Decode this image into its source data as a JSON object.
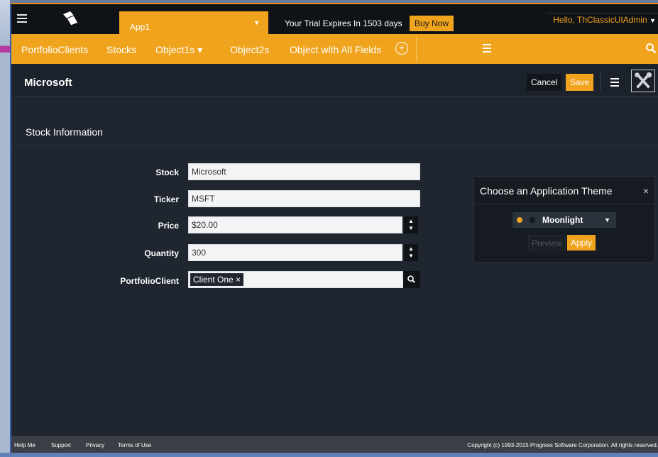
{
  "topbar": {
    "app_label": "App1",
    "trial_text": "Your Trial Expires In 1503 days",
    "buy_now_label": "Buy Now",
    "user_greeting": "Hello, ThClassicUIAdmin",
    "icons": [
      "menu-icon",
      "logo-icon",
      "chevron-down-icon"
    ]
  },
  "nav": {
    "items": [
      {
        "label": "PortfolioClients"
      },
      {
        "label": "Stocks"
      },
      {
        "label": "Object1s ▾"
      },
      {
        "label": "Object2s"
      },
      {
        "label": "Object with All Fields"
      }
    ],
    "icons": [
      "add-icon",
      "menu-icon",
      "search-icon"
    ]
  },
  "header": {
    "title": "Microsoft",
    "cancel_label": "Cancel",
    "save_label": "Save"
  },
  "section": {
    "title": "Stock Information"
  },
  "form": {
    "stock_label": "Stock",
    "stock_value": "Microsoft",
    "ticker_label": "Ticker",
    "ticker_value": "MSFT",
    "price_label": "Price",
    "price_value": "$20.00",
    "quantity_label": "Quantity",
    "quantity_value": "300",
    "client_label": "PortfolioClient",
    "client_chip": "Client One ×"
  },
  "theme_panel": {
    "title": "Choose an Application Theme",
    "close": "×",
    "selected_theme": "Moonlight",
    "preview_label": "Preview",
    "apply_label": "Apply"
  },
  "footer": {
    "links": [
      "Help Me",
      "Support",
      "Privacy",
      "Terms of Use"
    ],
    "copyright": "Copyright (c) 1993-2015 Progress Software Corporation. All rights reserved."
  },
  "colors": {
    "accent": "#f0a31c",
    "background": "#1f2630",
    "topbar": "#0f1216"
  }
}
